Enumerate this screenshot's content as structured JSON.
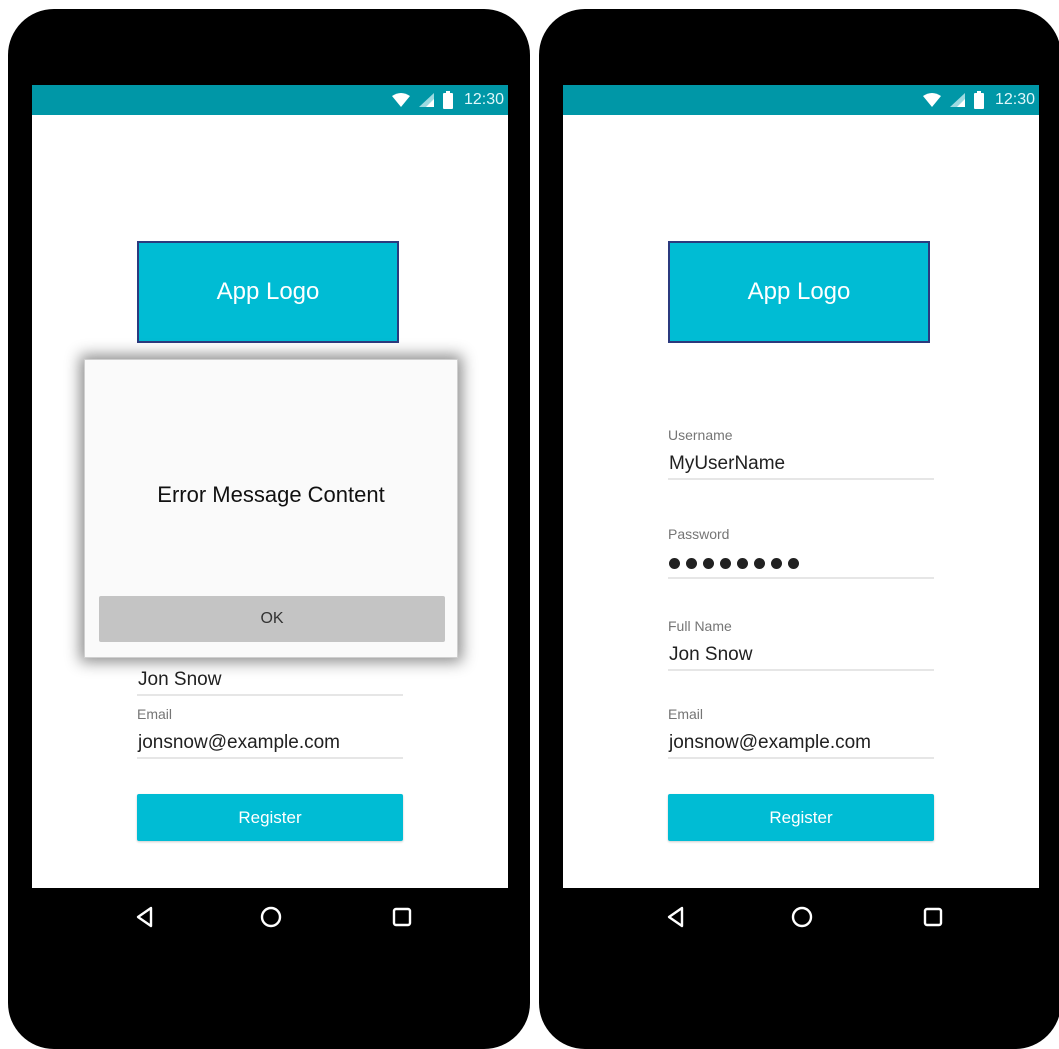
{
  "status_bar": {
    "time": "12:30"
  },
  "colors": {
    "accent": "#00bcd4",
    "status_bar": "#0097a7",
    "logo_border": "#2b3a7e",
    "dialog_button": "#c4c4c4"
  },
  "icons": [
    "wifi-icon",
    "signal-icon",
    "battery-icon",
    "back-icon",
    "home-icon",
    "recents-icon"
  ],
  "logo": {
    "text": "App Logo"
  },
  "dialog": {
    "message": "Error Message Content",
    "ok_label": "OK"
  },
  "form": {
    "username": {
      "label": "Username",
      "value": "MyUserName"
    },
    "password": {
      "label": "Password",
      "masked_length": 8
    },
    "full_name": {
      "label": "Full Name",
      "value": "Jon Snow"
    },
    "email": {
      "label": "Email",
      "value": "jonsnow@example.com"
    },
    "register_label": "Register"
  }
}
